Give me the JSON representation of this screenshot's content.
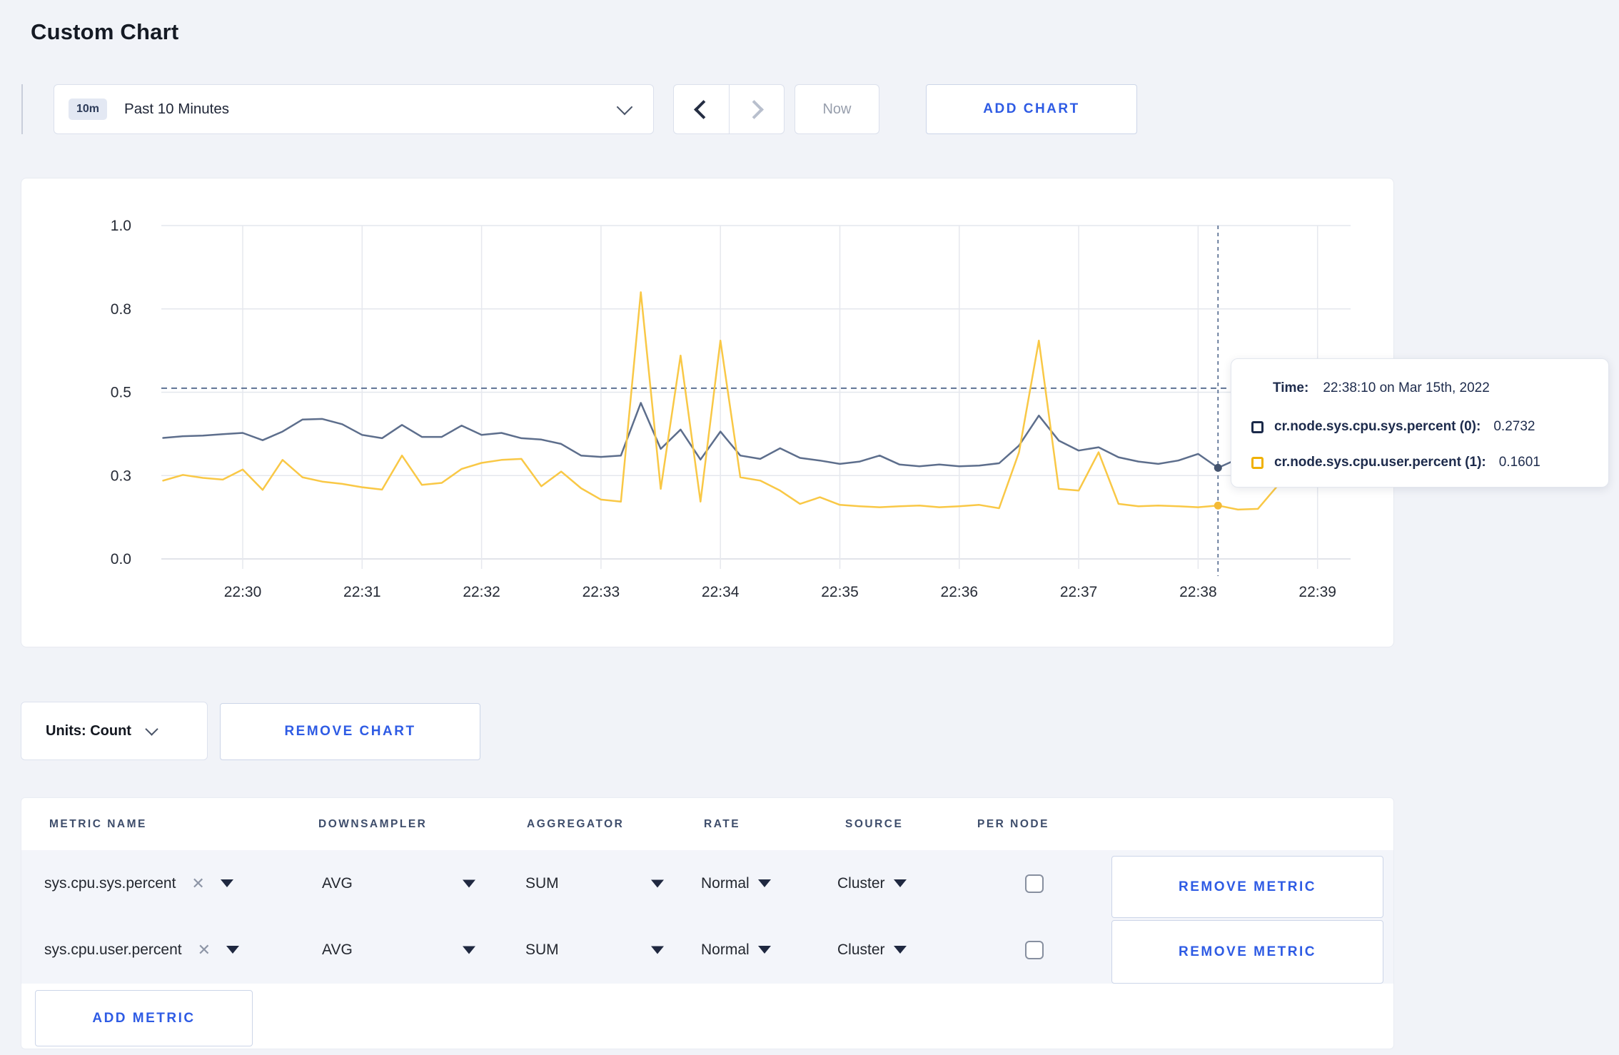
{
  "page": {
    "title": "Custom Chart",
    "background": "#f1f3f8",
    "accent_blue": "#2e5be4"
  },
  "toolbar": {
    "time_window_badge": "10m",
    "time_window_label": "Past 10 Minutes",
    "now_label": "Now",
    "add_chart_label": "ADD CHART"
  },
  "chart_data": {
    "type": "line",
    "title": "",
    "xlabel": "",
    "ylabel": "",
    "start_time": "22:29:20",
    "interval_seconds": 10,
    "x_tick_labels": [
      "22:30",
      "22:31",
      "22:32",
      "22:33",
      "22:34",
      "22:35",
      "22:36",
      "22:37",
      "22:38",
      "22:39"
    ],
    "y_tick_labels": [
      "0.0",
      "0.3",
      "0.5",
      "0.8",
      "1.0"
    ],
    "y_tick_values": [
      0,
      0.25,
      0.5,
      0.75,
      1.0
    ],
    "ylim": [
      0,
      1
    ],
    "grid": true,
    "legend_position": "tooltip",
    "threshold_value": 0.512,
    "crosshair_index": 53,
    "crosshair_time": "22:38:10",
    "series": [
      {
        "name": "cr.node.sys.cpu.sys.percent (0)",
        "color": "#5d6e8c",
        "dot_color": "#44546f",
        "values": [
          0.363,
          0.368,
          0.37,
          0.374,
          0.378,
          0.356,
          0.382,
          0.418,
          0.42,
          0.404,
          0.372,
          0.362,
          0.402,
          0.366,
          0.366,
          0.4,
          0.372,
          0.378,
          0.362,
          0.358,
          0.345,
          0.31,
          0.306,
          0.31,
          0.468,
          0.33,
          0.388,
          0.298,
          0.382,
          0.31,
          0.3,
          0.332,
          0.303,
          0.295,
          0.285,
          0.292,
          0.31,
          0.283,
          0.278,
          0.283,
          0.278,
          0.28,
          0.287,
          0.34,
          0.43,
          0.355,
          0.325,
          0.335,
          0.305,
          0.292,
          0.285,
          0.295,
          0.315,
          0.2732,
          0.3,
          0.315,
          0.308,
          0.3,
          0.298,
          0.302
        ]
      },
      {
        "name": "cr.node.sys.cpu.user.percent (1)",
        "color": "#f9c846",
        "dot_color": "#f4ba35",
        "values": [
          0.235,
          0.252,
          0.243,
          0.238,
          0.268,
          0.207,
          0.297,
          0.245,
          0.232,
          0.225,
          0.215,
          0.208,
          0.31,
          0.222,
          0.228,
          0.27,
          0.288,
          0.297,
          0.3,
          0.218,
          0.262,
          0.212,
          0.178,
          0.172,
          0.8,
          0.21,
          0.61,
          0.172,
          0.655,
          0.245,
          0.235,
          0.205,
          0.165,
          0.185,
          0.162,
          0.158,
          0.155,
          0.158,
          0.16,
          0.155,
          0.158,
          0.162,
          0.152,
          0.32,
          0.655,
          0.21,
          0.205,
          0.32,
          0.165,
          0.158,
          0.16,
          0.158,
          0.155,
          0.1601,
          0.148,
          0.15,
          0.22,
          0.295,
          0.26,
          0.27
        ]
      }
    ]
  },
  "tooltip": {
    "time_label": "Time:",
    "time_value": "22:38:10 on Mar 15th, 2022",
    "rows": [
      {
        "label": "cr.node.sys.cpu.sys.percent (0):",
        "value": "0.2732",
        "swatch_color": "#1b2a4a"
      },
      {
        "label": "cr.node.sys.cpu.user.percent (1):",
        "value": "0.1601",
        "swatch_color": "#f0b102"
      }
    ]
  },
  "chart_controls": {
    "units_label": "Units: Count",
    "remove_chart_label": "REMOVE CHART"
  },
  "icons": {
    "clear": "✕"
  },
  "metrics_table": {
    "headers": [
      "METRIC NAME",
      "DOWNSAMPLER",
      "AGGREGATOR",
      "RATE",
      "SOURCE",
      "PER NODE"
    ],
    "rows": [
      {
        "name": "sys.cpu.sys.percent",
        "downsampler": "AVG",
        "aggregator": "SUM",
        "rate": "Normal",
        "source": "Cluster",
        "per_node_checked": false,
        "remove_label": "REMOVE METRIC"
      },
      {
        "name": "sys.cpu.user.percent",
        "downsampler": "AVG",
        "aggregator": "SUM",
        "rate": "Normal",
        "source": "Cluster",
        "per_node_checked": false,
        "remove_label": "REMOVE METRIC"
      }
    ],
    "add_metric_label": "ADD METRIC"
  }
}
